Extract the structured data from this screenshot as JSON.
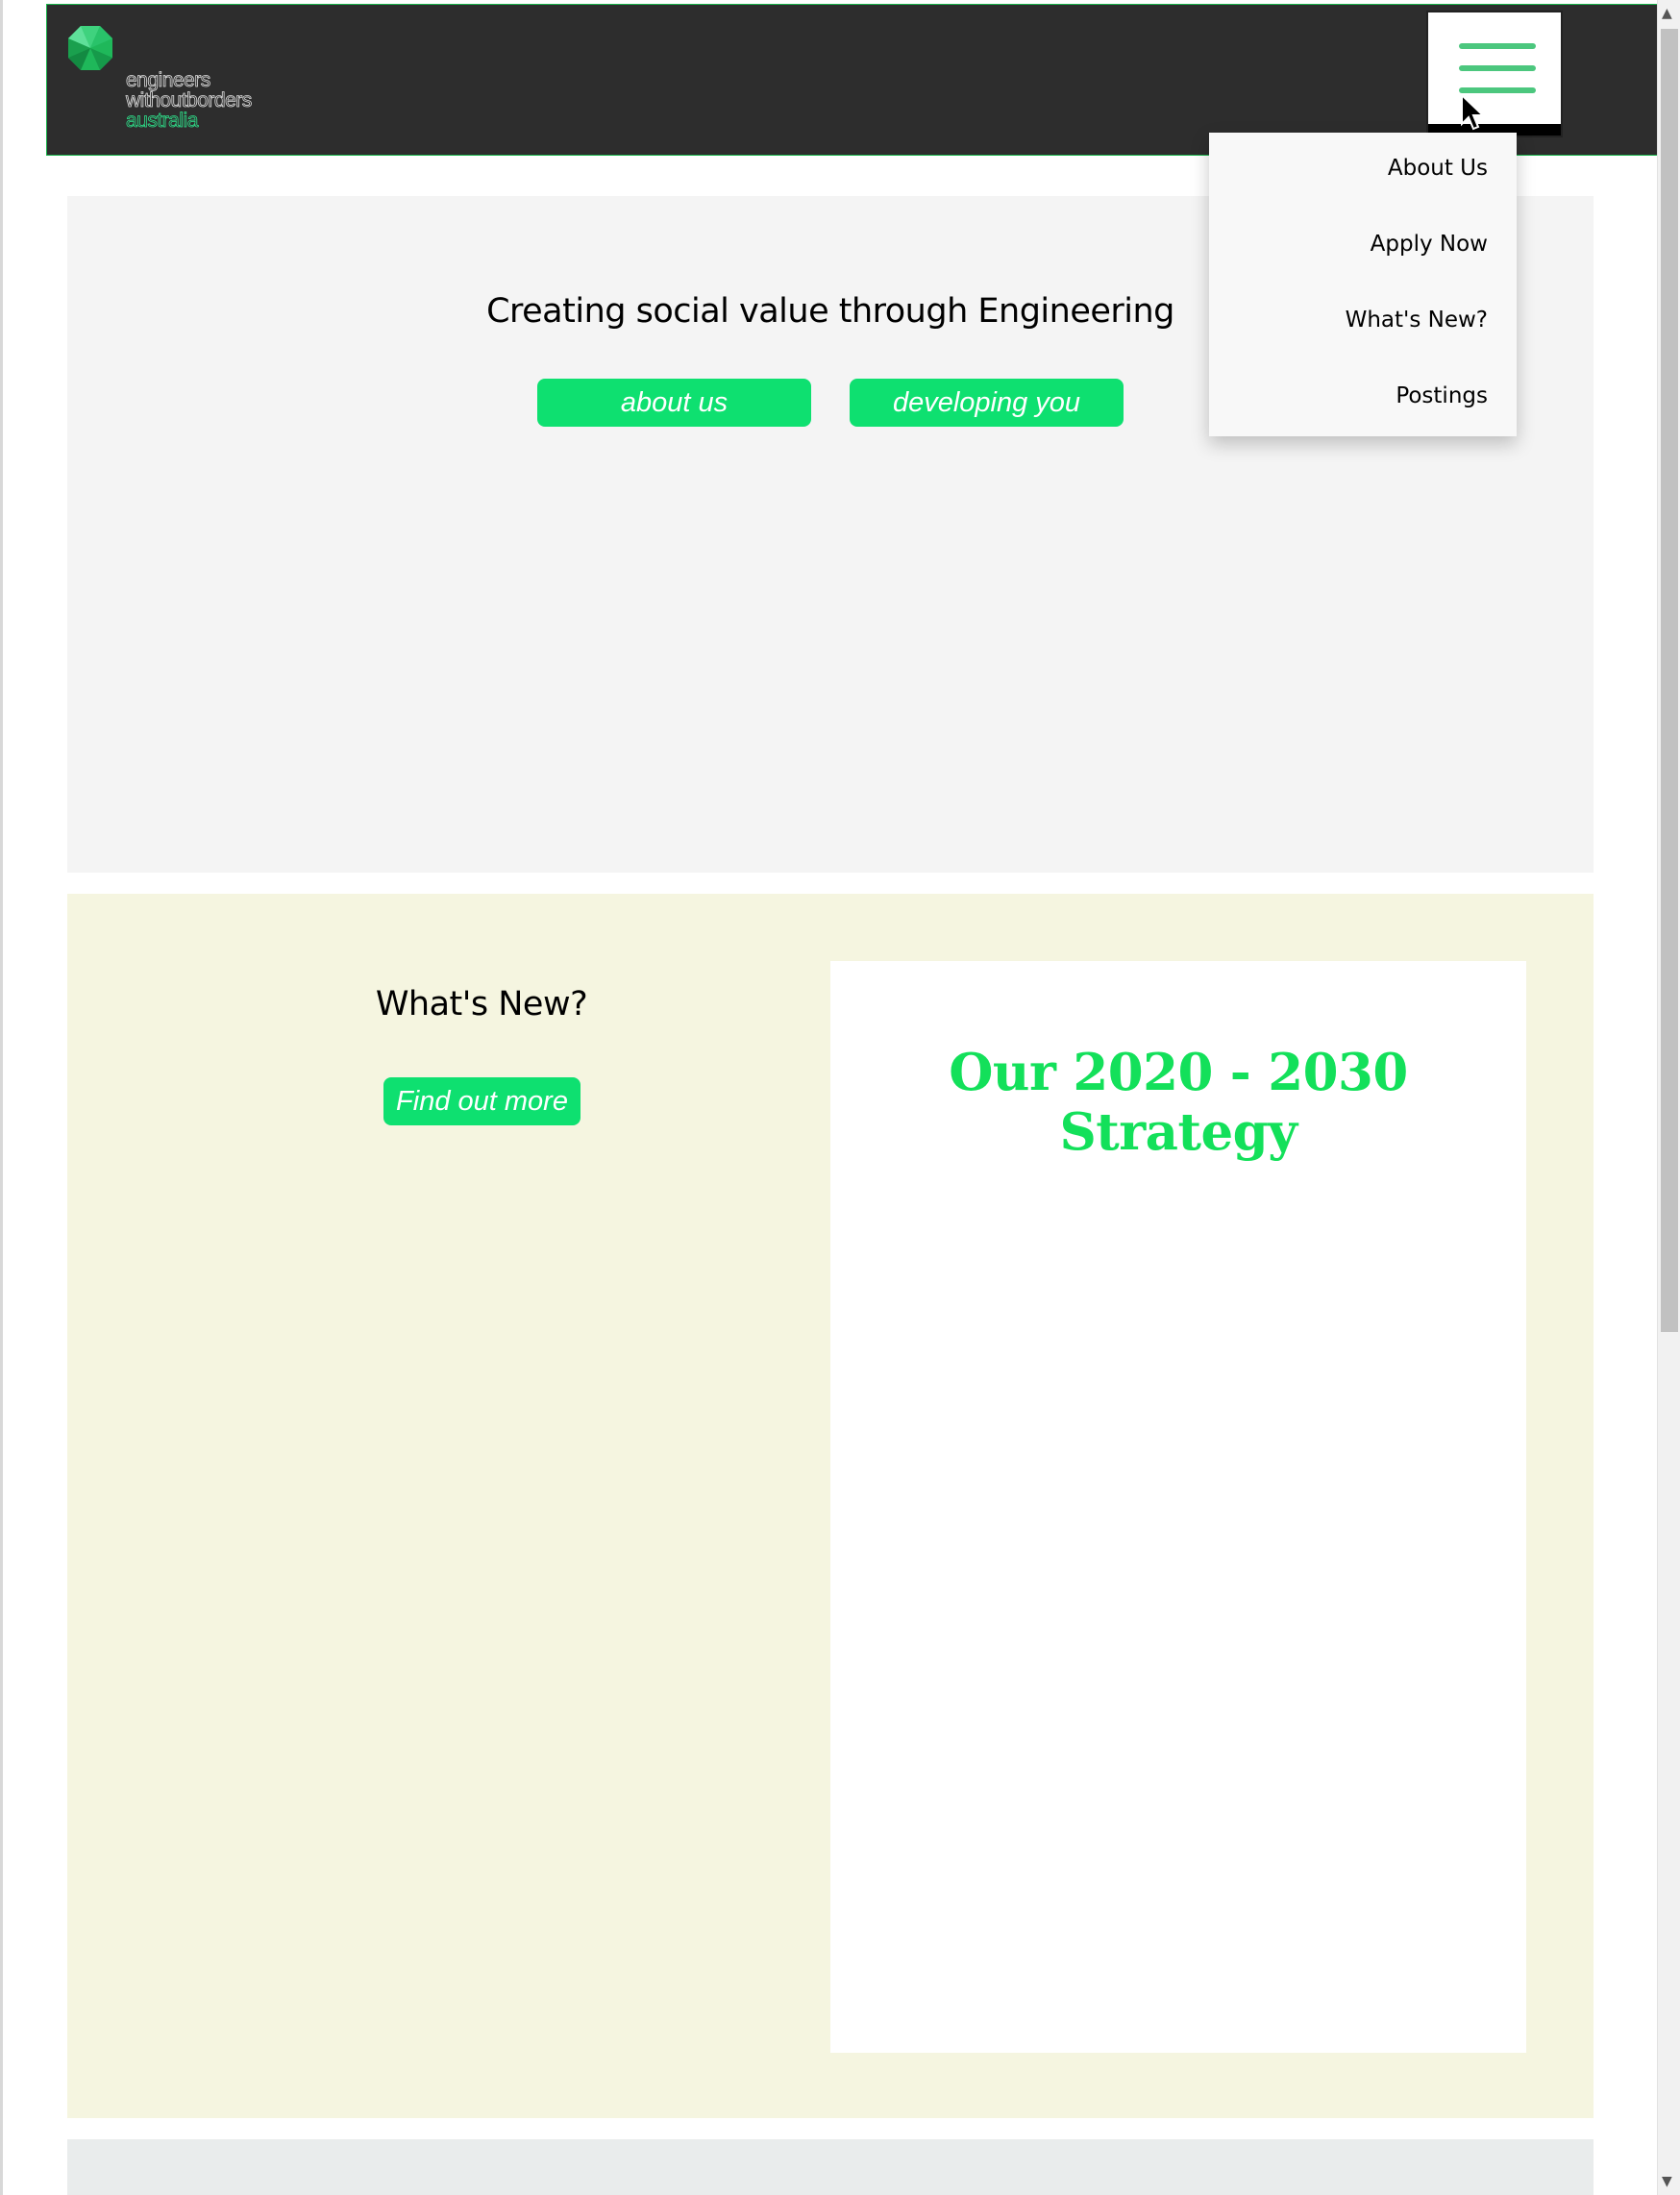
{
  "header": {
    "logo": {
      "line1": "engineers",
      "line2": "withoutborders",
      "line3": "australia"
    },
    "menu_icon": "hamburger-menu-icon"
  },
  "dropdown": {
    "items": [
      "About Us",
      "Apply Now",
      "What's New?",
      "Postings"
    ]
  },
  "hero": {
    "title": "Creating social value through Engineering",
    "buttons": [
      "about us",
      "developing you"
    ]
  },
  "whats_new": {
    "title": "What's New?",
    "button": "Find out more",
    "card_title": "Our 2020 - 2030 Strategy"
  },
  "colors": {
    "header_bg": "#2d2d2d",
    "accent_green": "#0ee070",
    "hero_bg": "#f4f4f4",
    "news_bg": "#f5f5e0",
    "strategy_green": "#13e05a"
  }
}
